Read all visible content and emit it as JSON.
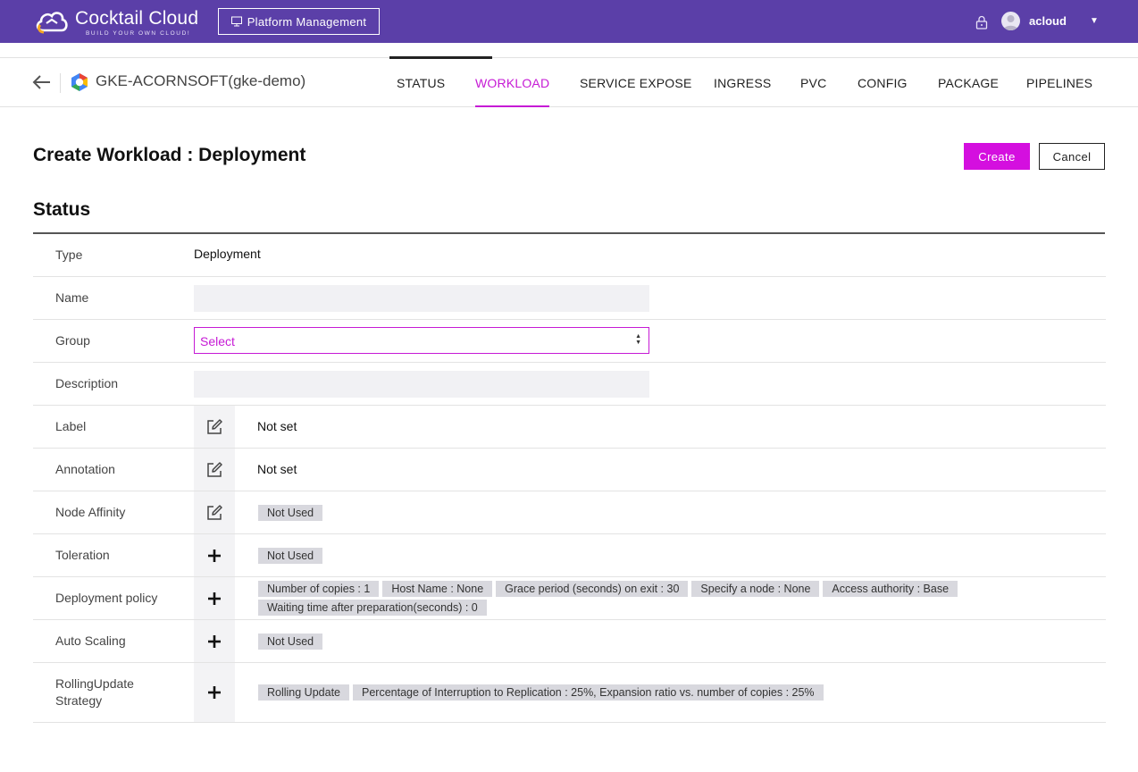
{
  "header": {
    "logo_text": "Cocktail Cloud",
    "logo_tagline": "BUILD YOUR OWN CLOUD!",
    "platform_button": "Platform Management",
    "username": "acloud",
    "colors": {
      "bar": "#5b3fa8",
      "accent": "#c61ad5"
    }
  },
  "subnav": {
    "cluster": "GKE-ACORNSOFT(gke-demo)",
    "tabs": [
      "STATUS",
      "WORKLOAD",
      "SERVICE EXPOSE",
      "INGRESS",
      "PVC",
      "CONFIG",
      "PACKAGE",
      "PIPELINES"
    ],
    "active_tab": "WORKLOAD"
  },
  "page": {
    "title": "Create Workload : Deployment",
    "create_label": "Create",
    "cancel_label": "Cancel",
    "section_title": "Status"
  },
  "form": {
    "type": {
      "label": "Type",
      "value": "Deployment"
    },
    "name": {
      "label": "Name",
      "value": ""
    },
    "group": {
      "label": "Group",
      "value": "Select"
    },
    "description": {
      "label": "Description",
      "value": ""
    },
    "label": {
      "label": "Label",
      "value": "Not set"
    },
    "annotation": {
      "label": "Annotation",
      "value": "Not set"
    },
    "node_affinity": {
      "label": "Node Affinity",
      "chip": "Not Used"
    },
    "toleration": {
      "label": "Toleration",
      "chip": "Not Used"
    },
    "deployment_policy": {
      "label": "Deployment policy",
      "chips": [
        "Number of copies : 1",
        "Host Name : None",
        "Grace period (seconds) on exit : 30",
        "Specify a node : None",
        "Access authority : Base",
        "Waiting time after preparation(seconds) : 0"
      ]
    },
    "auto_scaling": {
      "label": "Auto Scaling",
      "chip": "Not Used"
    },
    "rolling_update": {
      "label_line1": "RollingUpdate",
      "label_line2": "Strategy",
      "chips": [
        "Rolling Update",
        "Percentage of Interruption to Replication : 25%, Expansion ratio vs. number of copies : 25%"
      ]
    }
  }
}
